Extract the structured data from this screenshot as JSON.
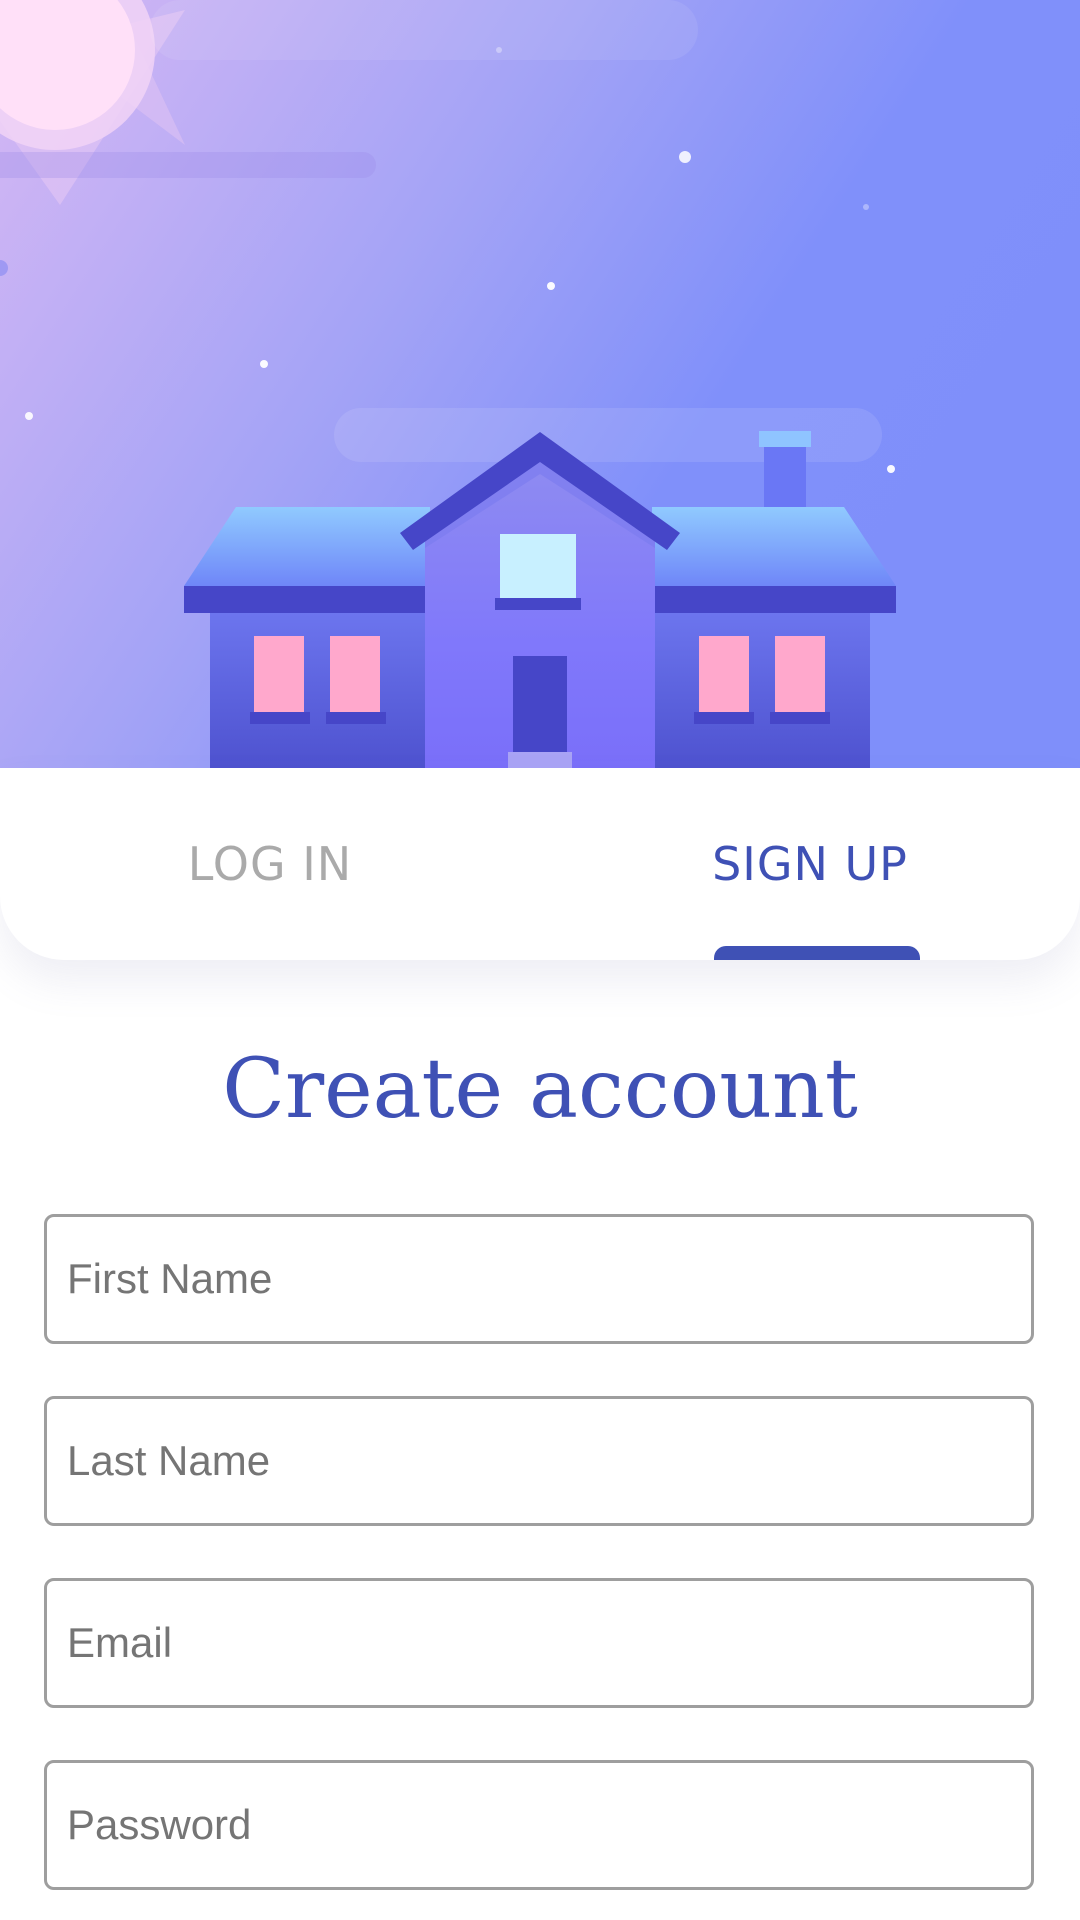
{
  "colors": {
    "accent": "#3f51b5",
    "tab_inactive": "#aaaaaa",
    "sky_top_left": "#d6b8f4",
    "sky_right": "#8090fa",
    "house_dark": "#4646c8",
    "window_pink": "#ffa8cc",
    "window_light": "#c8f0ff"
  },
  "tabs": [
    {
      "label": "LOG IN",
      "selected": false
    },
    {
      "label": "SIGN UP",
      "selected": true
    }
  ],
  "form": {
    "title": "Create account",
    "fields": {
      "first_name": {
        "placeholder": "First Name",
        "value": ""
      },
      "last_name": {
        "placeholder": "Last Name",
        "value": ""
      },
      "email": {
        "placeholder": "Email",
        "value": ""
      },
      "password": {
        "placeholder": "Password",
        "value": ""
      }
    }
  },
  "illustration": {
    "scene": "house-at-dusk-illustration",
    "icons": [
      "sun-icon",
      "house-icon",
      "star-icon",
      "cloud-icon",
      "chimney-icon"
    ]
  }
}
